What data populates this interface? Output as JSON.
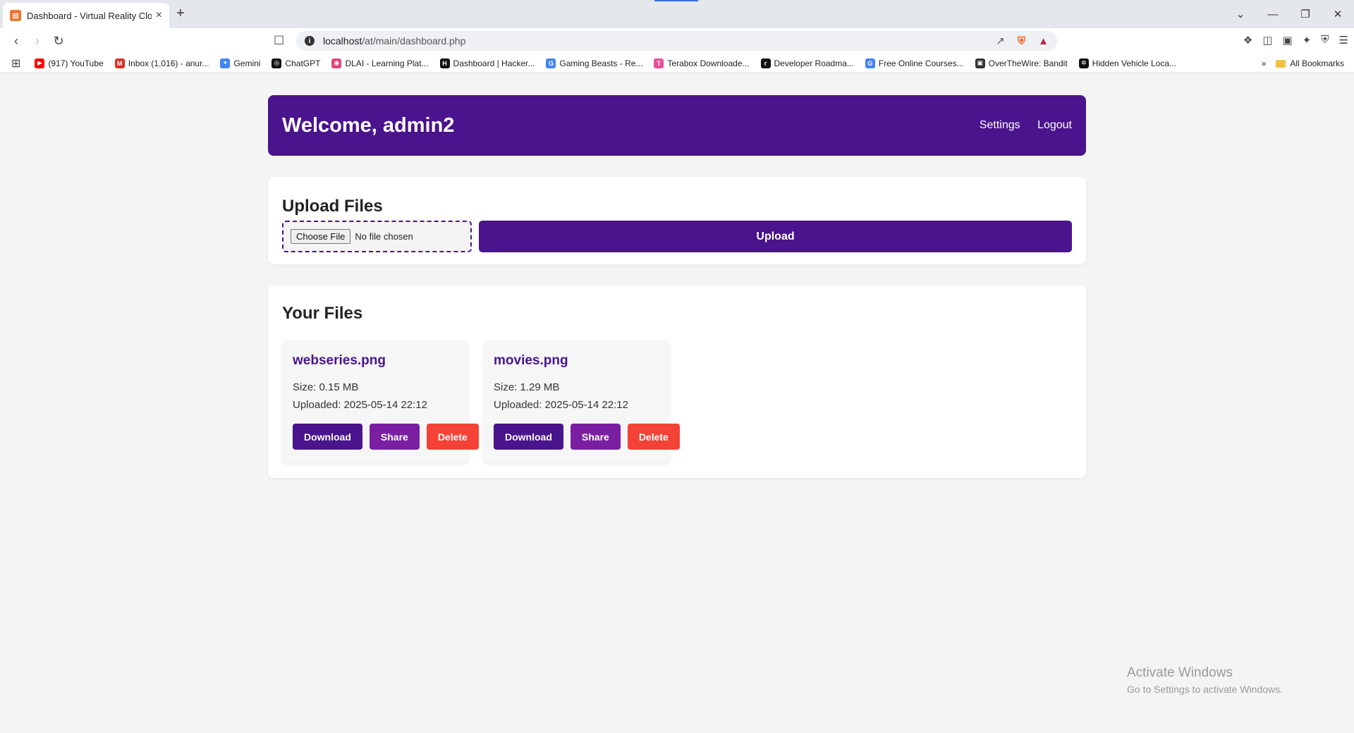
{
  "browser": {
    "tab_title": "Dashboard - Virtual Reality Clo",
    "new_tab": "+",
    "window_controls": [
      "⌄",
      "—",
      "❐",
      "✕"
    ],
    "url_host": "localhost",
    "url_path": "/at/main/dashboard.php",
    "bookmarks": [
      {
        "label": "(917) YouTube",
        "color": "#ff0000",
        "glyph": "▶"
      },
      {
        "label": "Inbox (1,016) - anur...",
        "color": "#d93025",
        "glyph": "M"
      },
      {
        "label": "Gemini",
        "color": "#4285f4",
        "glyph": "✦"
      },
      {
        "label": "ChatGPT",
        "color": "#111111",
        "glyph": "◎"
      },
      {
        "label": "DLAI - Learning Plat...",
        "color": "#e0457b",
        "glyph": "◉"
      },
      {
        "label": "Dashboard | Hacker...",
        "color": "#111111",
        "glyph": "H"
      },
      {
        "label": "Gaming Beasts - Re...",
        "color": "#4285f4",
        "glyph": "G"
      },
      {
        "label": "Terabox Downloade...",
        "color": "#e94e9a",
        "glyph": "T"
      },
      {
        "label": "Developer Roadma...",
        "color": "#111111",
        "glyph": "r"
      },
      {
        "label": "Free Online Courses...",
        "color": "#4285f4",
        "glyph": "G"
      },
      {
        "label": "OverTheWire: Bandit",
        "color": "#333333",
        "glyph": "▣"
      },
      {
        "label": "Hidden Vehicle Loca...",
        "color": "#111111",
        "glyph": "✲"
      }
    ],
    "more_bookmarks": "»",
    "all_bookmarks": "All Bookmarks"
  },
  "header": {
    "welcome": "Welcome, admin2",
    "settings": "Settings",
    "logout": "Logout"
  },
  "upload": {
    "title": "Upload Files",
    "choose_file": "Choose File",
    "no_file": "No file chosen",
    "upload_button": "Upload"
  },
  "files": {
    "title": "Your Files",
    "items": [
      {
        "name": "webseries.png",
        "size": "Size: 0.15 MB",
        "uploaded": "Uploaded: 2025-05-14 22:12"
      },
      {
        "name": "movies.png",
        "size": "Size: 1.29 MB",
        "uploaded": "Uploaded: 2025-05-14 22:12"
      }
    ],
    "download": "Download",
    "share": "Share",
    "delete": "Delete"
  },
  "watermark": {
    "title": "Activate Windows",
    "subtitle": "Go to Settings to activate Windows."
  },
  "colors": {
    "primary": "#4a148c",
    "share": "#7b1fa2",
    "delete": "#f44336",
    "background": "#f4f4f4"
  }
}
